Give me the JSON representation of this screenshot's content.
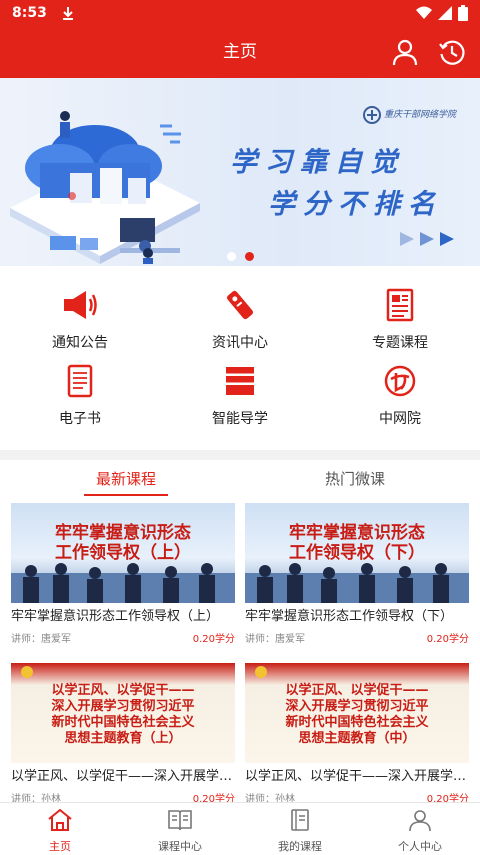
{
  "status_bar": {
    "time": "8:53"
  },
  "app_bar": {
    "title": "主页"
  },
  "banner": {
    "logo_text": "重庆干部网络学院",
    "slogan_line1": "学习靠自觉",
    "slogan_line2": "学分不排名",
    "slide_count": 2,
    "active_slide": 2
  },
  "menu": {
    "items": [
      {
        "label": "通知公告",
        "icon": "megaphone-icon"
      },
      {
        "label": "资讯中心",
        "icon": "tag-icon"
      },
      {
        "label": "专题课程",
        "icon": "document-icon"
      },
      {
        "label": "电子书",
        "icon": "ebook-icon"
      },
      {
        "label": "智能导学",
        "icon": "books-icon"
      },
      {
        "label": "中网院",
        "icon": "cnwy-logo-icon"
      }
    ]
  },
  "tabs": [
    {
      "label": "最新课程",
      "active": true
    },
    {
      "label": "热门微课",
      "active": false
    }
  ],
  "courses": [
    {
      "thumb_text": "牢牢掌握意识形态\n工作领导权（上）",
      "title": "牢牢掌握意识形态工作领导权（上）",
      "teacher": "讲师：唐爱军",
      "credit": "0.20学分",
      "style": "blue"
    },
    {
      "thumb_text": "牢牢掌握意识形态\n工作领导权（下）",
      "title": "牢牢掌握意识形态工作领导权（下）",
      "teacher": "讲师：唐爱军",
      "credit": "0.20学分",
      "style": "blue"
    },
    {
      "thumb_text": "以学正风、以学促干——\n深入开展学习贯彻习近平\n新时代中国特色社会主义\n思想主题教育（上）",
      "title": "以学正风、以学促干——深入开展学习贯彻习近平新时代中国特色社会主义思想主题教育（上）",
      "teacher": "讲师：孙林",
      "credit": "0.20学分",
      "style": "red"
    },
    {
      "thumb_text": "以学正风、以学促干——\n深入开展学习贯彻习近平\n新时代中国特色社会主义\n思想主题教育（中）",
      "title": "以学正风、以学促干——深入开展学习贯彻习近平新时代中国特色社会主义思想主题教育（中）",
      "teacher": "讲师：孙林",
      "credit": "0.20学分",
      "style": "red"
    }
  ],
  "bottom_nav": [
    {
      "label": "主页",
      "icon": "home-icon",
      "active": true
    },
    {
      "label": "课程中心",
      "icon": "book-open-icon",
      "active": false
    },
    {
      "label": "我的课程",
      "icon": "notebook-icon",
      "active": false
    },
    {
      "label": "个人中心",
      "icon": "person-icon",
      "active": false
    }
  ],
  "colors": {
    "primary": "#e2231a",
    "banner_text": "#2e66c8"
  }
}
